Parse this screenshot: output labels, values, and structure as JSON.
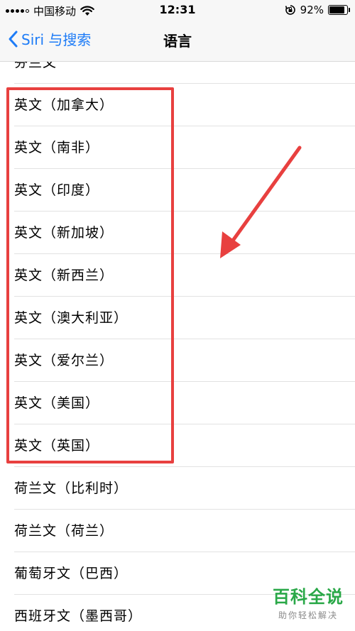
{
  "status_bar": {
    "carrier": "中国移动",
    "time": "12:31",
    "battery": "92%"
  },
  "nav": {
    "back_label": "Siri 与搜索",
    "title": "语言"
  },
  "languages": [
    "芬兰文",
    "英文（加拿大）",
    "英文（南非）",
    "英文（印度）",
    "英文（新加坡）",
    "英文（新西兰）",
    "英文（澳大利亚）",
    "英文（爱尔兰）",
    "英文（美国）",
    "英文（英国）",
    "荷兰文（比利时）",
    "荷兰文（荷兰）",
    "葡萄牙文（巴西）",
    "西班牙文（墨西哥）"
  ],
  "watermark": {
    "main": "百科全说",
    "sub": "助你轻松解决"
  },
  "colors": {
    "accent": "#1e7cf7",
    "highlight": "#e8403f",
    "watermark": "#2aa848"
  }
}
